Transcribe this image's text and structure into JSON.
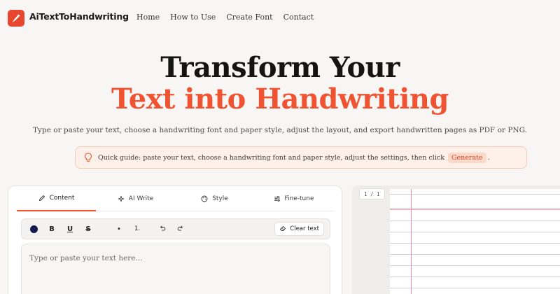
{
  "nav": {
    "brand": "AiTextToHandwriting",
    "links": [
      "Home",
      "How to Use",
      "Create Font",
      "Contact"
    ]
  },
  "hero": {
    "title_line1": "Transform Your",
    "title_line2": "Text into Handwriting",
    "subtitle": "Type or paste your text, choose a handwriting font and paper style, adjust the layout, and export handwritten pages as PDF or PNG."
  },
  "guide": {
    "icon": "lightbulb-icon",
    "text": "Quick guide: paste your text, choose a handwriting font and paper style, adjust the settings, then click",
    "chip": "Generate",
    "end": "."
  },
  "editor": {
    "tabs": [
      {
        "label": "Content",
        "icon": "pen-icon",
        "active": true
      },
      {
        "label": "AI Write",
        "icon": "sparkle-icon",
        "active": false
      },
      {
        "label": "Style",
        "icon": "palette-icon",
        "active": false
      },
      {
        "label": "Fine-tune",
        "icon": "sliders-icon",
        "active": false
      }
    ],
    "toolbar": {
      "ink_color": "#141b4d",
      "bold": "B",
      "underline": "U",
      "strike": "S",
      "bullet": "•",
      "numbered": "1.",
      "clear_label": "Clear text"
    },
    "text_placeholder": "Type or paste your text here..."
  },
  "preview": {
    "page_counter": "1 / 1"
  },
  "colors": {
    "accent": "#ef5331",
    "background": "#f7f6f4",
    "guide_bg": "#fdf0e8",
    "paper_line": "#c8cfe6",
    "paper_margin": "#f08ea0"
  }
}
